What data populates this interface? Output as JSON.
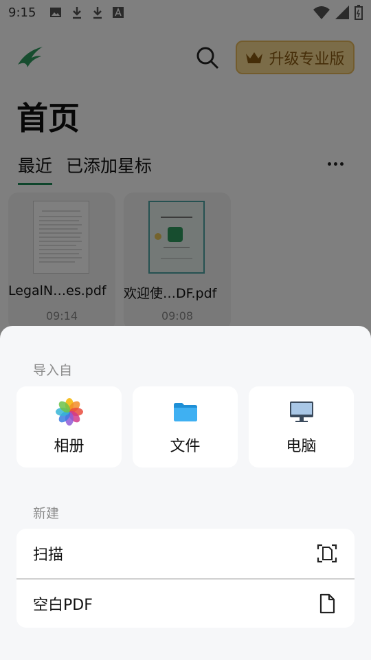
{
  "status_bar": {
    "time": "9:15"
  },
  "header": {
    "upgrade_label": "升级专业版",
    "title": "首页"
  },
  "tabs": [
    {
      "label": "最近"
    },
    {
      "label": "已添加星标"
    }
  ],
  "files": [
    {
      "name": "LegalN…es.pdf",
      "time": "09:14"
    },
    {
      "name": "欢迎使…DF.pdf",
      "time": "09:08"
    }
  ],
  "sheet": {
    "import_label": "导入自",
    "import_options": [
      {
        "label": "相册",
        "icon": "photos-icon"
      },
      {
        "label": "文件",
        "icon": "folder-icon"
      },
      {
        "label": "电脑",
        "icon": "monitor-icon"
      }
    ],
    "new_label": "新建",
    "new_options": [
      {
        "label": "扫描",
        "icon": "scan-document-icon"
      },
      {
        "label": "空白PDF",
        "icon": "blank-document-icon"
      }
    ]
  },
  "colors": {
    "accent": "#1d8a57",
    "upgrade_bg": "#f7d991"
  }
}
